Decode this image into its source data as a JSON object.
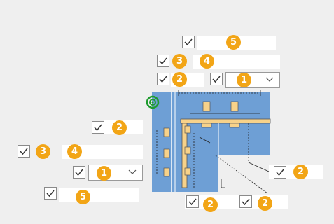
{
  "colors": {
    "accent": "#f2a516",
    "panel": "#6e9fd5",
    "beam": "#f7d28a",
    "target": "#1f9c2f"
  },
  "icons": {
    "checkbox": "checkmark-icon",
    "dropdown": "chevron-down-icon",
    "target": "target-icon"
  },
  "top": {
    "row5_badge": "5",
    "row4_badge_a": "3",
    "row4_badge_b": "4",
    "row3_badge_a": "2",
    "row3_badge_b": "1"
  },
  "left": {
    "badge_2": "2",
    "badge_3": "3",
    "badge_4": "4",
    "badge_1": "1",
    "badge_5": "5"
  },
  "right": {
    "badge_2": "2"
  },
  "bottom": {
    "badge_a": "2",
    "badge_b": "2"
  }
}
